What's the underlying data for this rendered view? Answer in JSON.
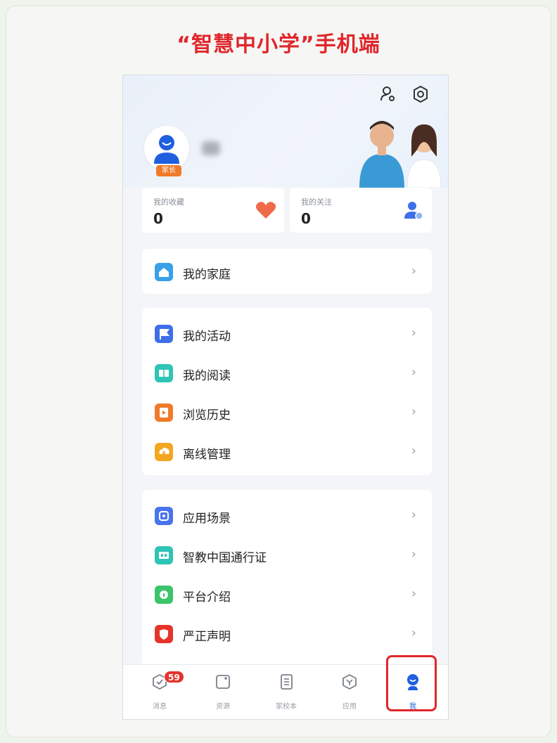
{
  "slide_title": "“智慧中小学”手机端",
  "colors": {
    "accent": "#e0262b",
    "brand_blue": "#2a6fe8",
    "parent_badge": "#f07a2a"
  },
  "header": {
    "icons": [
      "user-switch-icon",
      "settings-icon"
    ],
    "user": {
      "role_badge": "家长"
    }
  },
  "stats": [
    {
      "label": "我的收藏",
      "value": "0",
      "icon": "heart-icon"
    },
    {
      "label": "我的关注",
      "value": "0",
      "icon": "follow-user-icon"
    }
  ],
  "menu_groups": [
    {
      "items": [
        {
          "label": "我的家庭",
          "icon": "home-icon",
          "color": "#3aa0e8"
        }
      ]
    },
    {
      "items": [
        {
          "label": "我的活动",
          "icon": "flag-icon",
          "color": "#3f6fe8"
        },
        {
          "label": "我的阅读",
          "icon": "reading-icon",
          "color": "#2ec4b6"
        },
        {
          "label": "浏览历史",
          "icon": "history-icon",
          "color": "#ef7b2a"
        },
        {
          "label": "离线管理",
          "icon": "download-icon",
          "color": "#f3a623"
        }
      ]
    },
    {
      "items": [
        {
          "label": "应用场景",
          "icon": "scene-icon",
          "color": "#4a74ee"
        },
        {
          "label": "智教中国通行证",
          "icon": "pass-card-icon",
          "color": "#2ec4b6"
        },
        {
          "label": "平台介绍",
          "icon": "info-icon",
          "color": "#3cc46a"
        },
        {
          "label": "严正声明",
          "icon": "shield-icon",
          "color": "#e5342b"
        }
      ]
    }
  ],
  "chevron": "›",
  "tabbar": {
    "tabs": [
      {
        "label": "消息",
        "icon": "message-icon",
        "badge": "59"
      },
      {
        "label": "资源",
        "icon": "resource-icon"
      },
      {
        "label": "家校本",
        "icon": "notebook-icon"
      },
      {
        "label": "应用",
        "icon": "apps-icon"
      },
      {
        "label": "我",
        "icon": "profile-icon",
        "active": true
      }
    ]
  }
}
